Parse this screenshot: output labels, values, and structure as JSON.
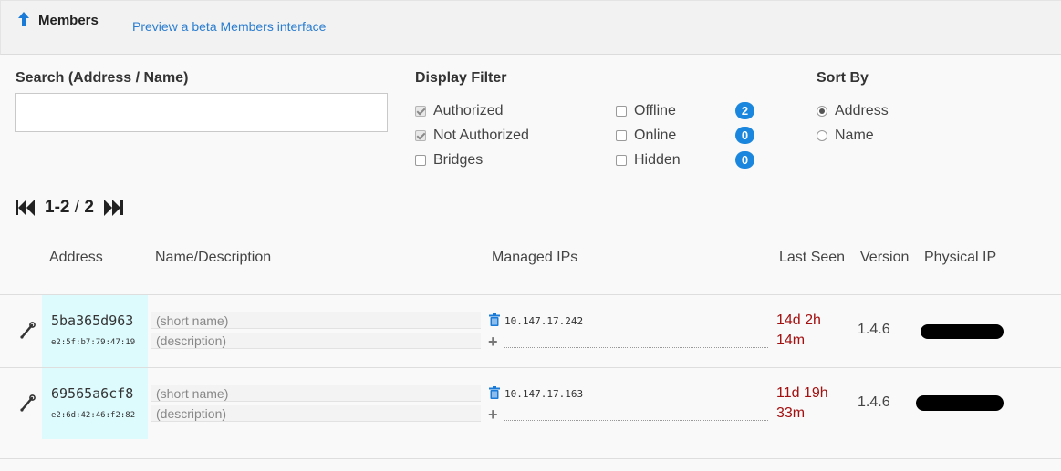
{
  "header": {
    "title": "Members",
    "beta_link": "Preview a beta Members interface"
  },
  "search": {
    "label": "Search (Address / Name)",
    "value": "",
    "placeholder": ""
  },
  "display_filter": {
    "label": "Display Filter",
    "authorized": {
      "label": "Authorized",
      "checked": true
    },
    "not_authorized": {
      "label": "Not Authorized",
      "checked": true
    },
    "bridges": {
      "label": "Bridges",
      "checked": false
    },
    "offline": {
      "label": "Offline",
      "checked": false,
      "count": "2"
    },
    "online": {
      "label": "Online",
      "checked": false,
      "count": "0"
    },
    "hidden": {
      "label": "Hidden",
      "checked": false,
      "count": "0"
    }
  },
  "sort_by": {
    "label": "Sort By",
    "address": {
      "label": "Address",
      "selected": true
    },
    "name": {
      "label": "Name",
      "selected": false
    }
  },
  "pager": {
    "range": "1-2",
    "separator": "/",
    "total": "2"
  },
  "table": {
    "columns": {
      "address": "Address",
      "name": "Name/Description",
      "managed_ips": "Managed IPs",
      "last_seen": "Last Seen",
      "version": "Version",
      "physical_ip": "Physical IP"
    },
    "rows": [
      {
        "address": "5ba365d963",
        "mac": "e2:5f:b7:79:47:19",
        "name_placeholder": "(short name)",
        "desc_placeholder": "(description)",
        "managed_ip": "10.147.17.242",
        "last_seen_1": "14d 2h",
        "last_seen_2": "14m",
        "version": "1.4.6"
      },
      {
        "address": "69565a6cf8",
        "mac": "e2:6d:42:46:f2:82",
        "name_placeholder": "(short name)",
        "desc_placeholder": "(description)",
        "managed_ip": "10.147.17.163",
        "last_seen_1": "11d 19h",
        "last_seen_2": "33m",
        "version": "1.4.6"
      }
    ]
  },
  "colors": {
    "link": "#2a7dd0",
    "badge": "#1a86dd",
    "last_seen": "#a31010",
    "address_cell": "#ddfafd"
  },
  "icons": {
    "collapse": "arrow-up-icon",
    "prev": "double-left-arrow-icon",
    "next": "double-right-arrow-icon",
    "row_action": "wrench-icon",
    "delete_ip": "trash-icon",
    "add_ip": "plus-icon"
  }
}
